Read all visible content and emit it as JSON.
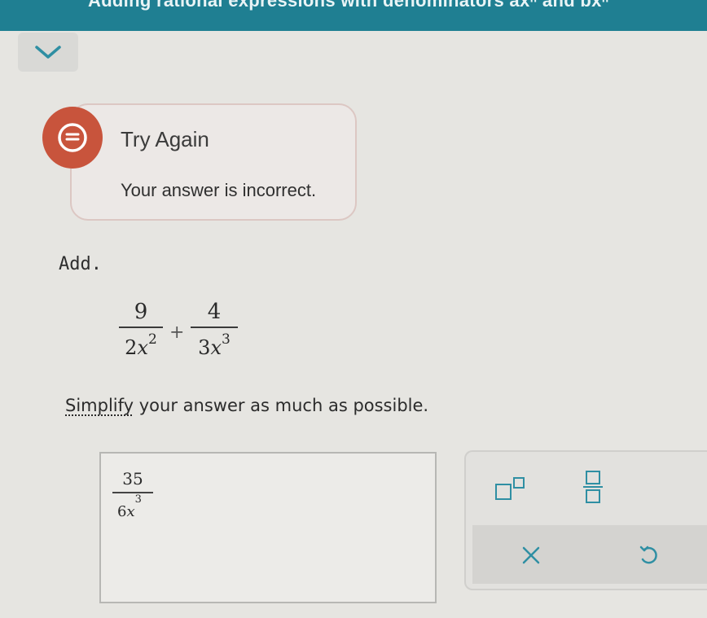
{
  "header": {
    "title": "Adding rational expressions with denominators axⁿ and bxⁿ"
  },
  "feedback": {
    "title": "Try Again",
    "message": "Your answer is incorrect."
  },
  "problem": {
    "instruction": "Add.",
    "term1": {
      "numerator": "9",
      "coef": "2",
      "var": "x",
      "exp": "2"
    },
    "operator": "+",
    "term2": {
      "numerator": "4",
      "coef": "3",
      "var": "x",
      "exp": "3"
    },
    "simplify_link": "Simplify",
    "simplify_rest": " your answer as much as possible."
  },
  "answer": {
    "numerator": "35",
    "coef": "6",
    "var": "x",
    "exp": "3"
  },
  "colors": {
    "header": "#1f7f92",
    "feedback_icon": "#c8543c",
    "key_icon": "#2f8fa3"
  }
}
